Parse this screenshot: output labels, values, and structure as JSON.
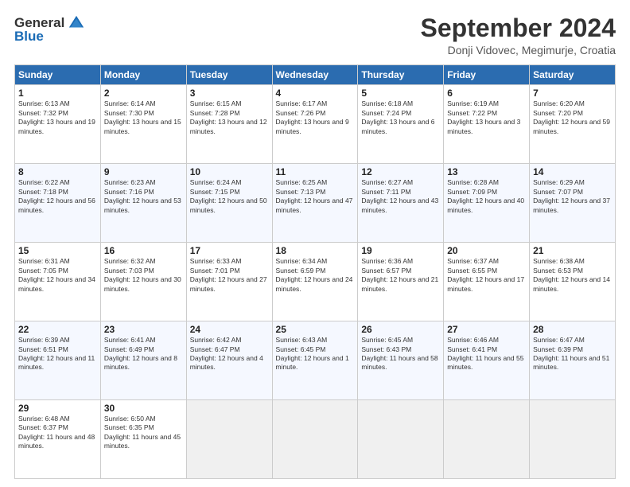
{
  "header": {
    "logo_general": "General",
    "logo_blue": "Blue",
    "month_title": "September 2024",
    "location": "Donji Vidovec, Megimurje, Croatia"
  },
  "weekdays": [
    "Sunday",
    "Monday",
    "Tuesday",
    "Wednesday",
    "Thursday",
    "Friday",
    "Saturday"
  ],
  "weeks": [
    [
      {
        "day": "1",
        "info": "Sunrise: 6:13 AM\nSunset: 7:32 PM\nDaylight: 13 hours and 19 minutes."
      },
      {
        "day": "2",
        "info": "Sunrise: 6:14 AM\nSunset: 7:30 PM\nDaylight: 13 hours and 15 minutes."
      },
      {
        "day": "3",
        "info": "Sunrise: 6:15 AM\nSunset: 7:28 PM\nDaylight: 13 hours and 12 minutes."
      },
      {
        "day": "4",
        "info": "Sunrise: 6:17 AM\nSunset: 7:26 PM\nDaylight: 13 hours and 9 minutes."
      },
      {
        "day": "5",
        "info": "Sunrise: 6:18 AM\nSunset: 7:24 PM\nDaylight: 13 hours and 6 minutes."
      },
      {
        "day": "6",
        "info": "Sunrise: 6:19 AM\nSunset: 7:22 PM\nDaylight: 13 hours and 3 minutes."
      },
      {
        "day": "7",
        "info": "Sunrise: 6:20 AM\nSunset: 7:20 PM\nDaylight: 12 hours and 59 minutes."
      }
    ],
    [
      {
        "day": "8",
        "info": "Sunrise: 6:22 AM\nSunset: 7:18 PM\nDaylight: 12 hours and 56 minutes."
      },
      {
        "day": "9",
        "info": "Sunrise: 6:23 AM\nSunset: 7:16 PM\nDaylight: 12 hours and 53 minutes."
      },
      {
        "day": "10",
        "info": "Sunrise: 6:24 AM\nSunset: 7:15 PM\nDaylight: 12 hours and 50 minutes."
      },
      {
        "day": "11",
        "info": "Sunrise: 6:25 AM\nSunset: 7:13 PM\nDaylight: 12 hours and 47 minutes."
      },
      {
        "day": "12",
        "info": "Sunrise: 6:27 AM\nSunset: 7:11 PM\nDaylight: 12 hours and 43 minutes."
      },
      {
        "day": "13",
        "info": "Sunrise: 6:28 AM\nSunset: 7:09 PM\nDaylight: 12 hours and 40 minutes."
      },
      {
        "day": "14",
        "info": "Sunrise: 6:29 AM\nSunset: 7:07 PM\nDaylight: 12 hours and 37 minutes."
      }
    ],
    [
      {
        "day": "15",
        "info": "Sunrise: 6:31 AM\nSunset: 7:05 PM\nDaylight: 12 hours and 34 minutes."
      },
      {
        "day": "16",
        "info": "Sunrise: 6:32 AM\nSunset: 7:03 PM\nDaylight: 12 hours and 30 minutes."
      },
      {
        "day": "17",
        "info": "Sunrise: 6:33 AM\nSunset: 7:01 PM\nDaylight: 12 hours and 27 minutes."
      },
      {
        "day": "18",
        "info": "Sunrise: 6:34 AM\nSunset: 6:59 PM\nDaylight: 12 hours and 24 minutes."
      },
      {
        "day": "19",
        "info": "Sunrise: 6:36 AM\nSunset: 6:57 PM\nDaylight: 12 hours and 21 minutes."
      },
      {
        "day": "20",
        "info": "Sunrise: 6:37 AM\nSunset: 6:55 PM\nDaylight: 12 hours and 17 minutes."
      },
      {
        "day": "21",
        "info": "Sunrise: 6:38 AM\nSunset: 6:53 PM\nDaylight: 12 hours and 14 minutes."
      }
    ],
    [
      {
        "day": "22",
        "info": "Sunrise: 6:39 AM\nSunset: 6:51 PM\nDaylight: 12 hours and 11 minutes."
      },
      {
        "day": "23",
        "info": "Sunrise: 6:41 AM\nSunset: 6:49 PM\nDaylight: 12 hours and 8 minutes."
      },
      {
        "day": "24",
        "info": "Sunrise: 6:42 AM\nSunset: 6:47 PM\nDaylight: 12 hours and 4 minutes."
      },
      {
        "day": "25",
        "info": "Sunrise: 6:43 AM\nSunset: 6:45 PM\nDaylight: 12 hours and 1 minute."
      },
      {
        "day": "26",
        "info": "Sunrise: 6:45 AM\nSunset: 6:43 PM\nDaylight: 11 hours and 58 minutes."
      },
      {
        "day": "27",
        "info": "Sunrise: 6:46 AM\nSunset: 6:41 PM\nDaylight: 11 hours and 55 minutes."
      },
      {
        "day": "28",
        "info": "Sunrise: 6:47 AM\nSunset: 6:39 PM\nDaylight: 11 hours and 51 minutes."
      }
    ],
    [
      {
        "day": "29",
        "info": "Sunrise: 6:48 AM\nSunset: 6:37 PM\nDaylight: 11 hours and 48 minutes."
      },
      {
        "day": "30",
        "info": "Sunrise: 6:50 AM\nSunset: 6:35 PM\nDaylight: 11 hours and 45 minutes."
      },
      {
        "day": "",
        "info": ""
      },
      {
        "day": "",
        "info": ""
      },
      {
        "day": "",
        "info": ""
      },
      {
        "day": "",
        "info": ""
      },
      {
        "day": "",
        "info": ""
      }
    ]
  ]
}
